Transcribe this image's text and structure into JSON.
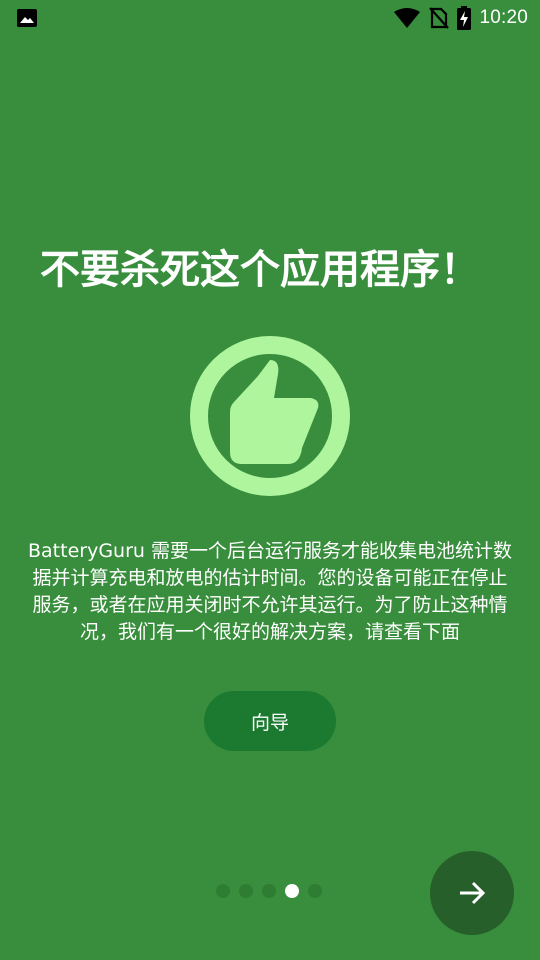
{
  "status_bar": {
    "time": "10:20",
    "icons": [
      "image-notification-icon",
      "wifi-icon",
      "no-sim-icon",
      "battery-charging-icon"
    ]
  },
  "page": {
    "title": "不要杀死这个应用程序！",
    "hero_icon": "thumbs-up-icon",
    "description": "BatteryGuru 需要一个后台运行服务才能收集电池统计数据并计算充电和放电的估计时间。您的设备可能正在停止服务，或者在应用关闭时不允许其运行。为了防止这种情况，我们有一个很好的解决方案，请查看下面",
    "guide_button_label": "向导"
  },
  "pager": {
    "total": 5,
    "active_index": 3
  },
  "next_button": {
    "icon": "arrow-right-icon"
  },
  "colors": {
    "background": "#388e3c",
    "accent_light": "#aef59d",
    "button_dark": "#1b7a30",
    "fab": "#265f2a",
    "dot_inactive": "#2e7d32",
    "dot_active": "#ffffff"
  }
}
